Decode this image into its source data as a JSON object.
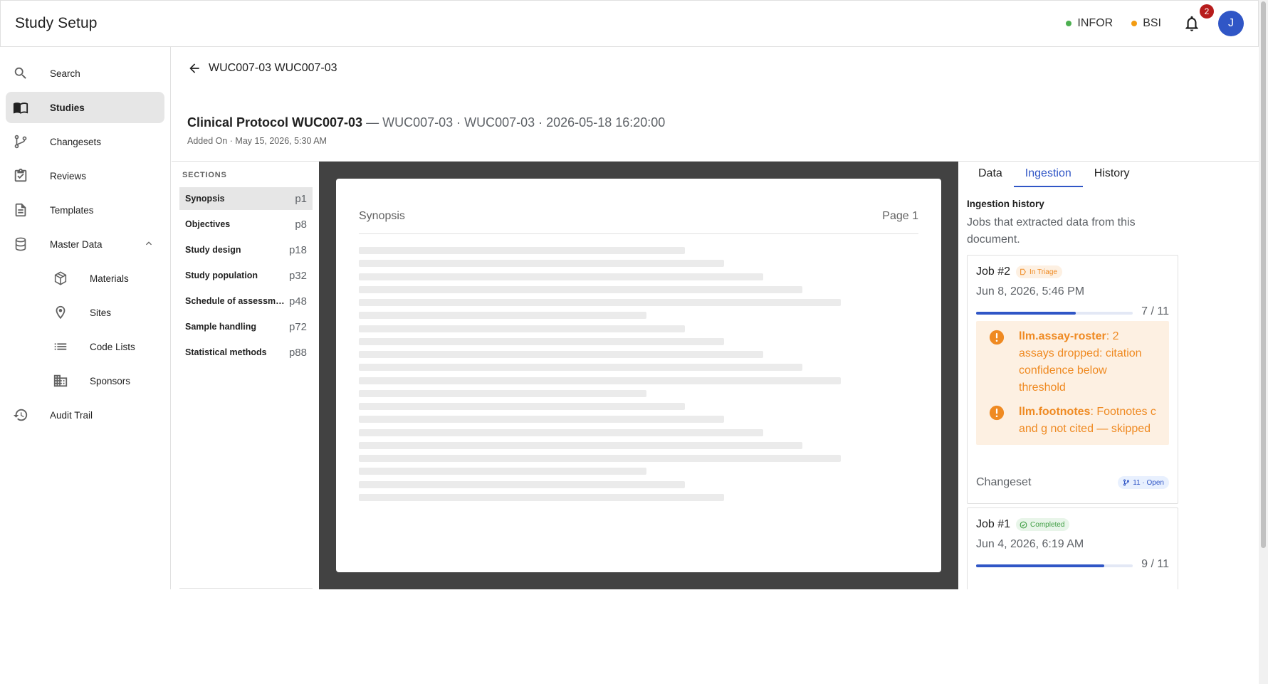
{
  "header": {
    "app_title": "Study Setup",
    "envs": [
      {
        "label": "INFOR",
        "color": "#4caf50"
      },
      {
        "label": "BSI",
        "color": "#f39c12"
      }
    ],
    "notification_count": "2",
    "avatar_initial": "J"
  },
  "sidebar": {
    "items": [
      {
        "label": "Search",
        "icon": "search-icon"
      },
      {
        "label": "Studies",
        "icon": "studies-book-icon"
      },
      {
        "label": "Changesets",
        "icon": "branch-icon"
      },
      {
        "label": "Reviews",
        "icon": "clipboard-check-icon"
      },
      {
        "label": "Templates",
        "icon": "document-icon"
      },
      {
        "label": "Master Data",
        "icon": "database-icon"
      },
      {
        "label": "Materials",
        "icon": "cube-icon"
      },
      {
        "label": "Sites",
        "icon": "location-pin-icon"
      },
      {
        "label": "Code Lists",
        "icon": "list-icon"
      },
      {
        "label": "Sponsors",
        "icon": "building-icon"
      },
      {
        "label": "Audit Trail",
        "icon": "history-icon"
      }
    ]
  },
  "breadcrumb": {
    "label": "WUC007-03 WUC007-03"
  },
  "document": {
    "title": "Clinical Protocol WUC007-03",
    "meta": "— WUC007-03 · WUC007-03 · 2026-05-18 16:20:00",
    "added_on": "Added On · May 15, 2026, 5:30 AM"
  },
  "sections": {
    "label": "SECTIONS",
    "items": [
      {
        "name": "Synopsis",
        "page": "p1"
      },
      {
        "name": "Objectives",
        "page": "p8"
      },
      {
        "name": "Study design",
        "page": "p18"
      },
      {
        "name": "Study population",
        "page": "p32"
      },
      {
        "name": "Schedule of assessments",
        "page": "p48"
      },
      {
        "name": "Sample handling",
        "page": "p72"
      },
      {
        "name": "Statistical methods",
        "page": "p88"
      }
    ]
  },
  "viewer": {
    "section_title": "Synopsis",
    "page_label": "Page 1"
  },
  "right_panel": {
    "tabs": [
      "Data",
      "Ingestion",
      "History"
    ],
    "active_tab": "Ingestion",
    "ingestion_title": "Ingestion history",
    "ingestion_desc": "Jobs that extracted data from this document.",
    "jobs": [
      {
        "name": "Job #2",
        "status": "In Triage",
        "date": "Jun 8, 2026, 5:46 PM",
        "done": 7,
        "total": 11,
        "progress_text": "7 / 11",
        "alerts": [
          {
            "key": "llm.assay-roster",
            "text": ": 2 assays dropped: citation confidence below threshold"
          },
          {
            "key": "llm.footnotes",
            "text": ": Footnotes c and g not cited — skipped"
          }
        ],
        "changeset_label": "Changeset",
        "changeset_chip": "11 · Open"
      },
      {
        "name": "Job #1",
        "status": "Completed",
        "date": "Jun 4, 2026, 6:19 AM",
        "done": 9,
        "total": 11,
        "progress_text": "9 / 11"
      }
    ]
  },
  "colors": {
    "accent": "#3056c6",
    "warning": "#ef8a22",
    "success": "#43a047",
    "badge": "#b71c1c"
  }
}
